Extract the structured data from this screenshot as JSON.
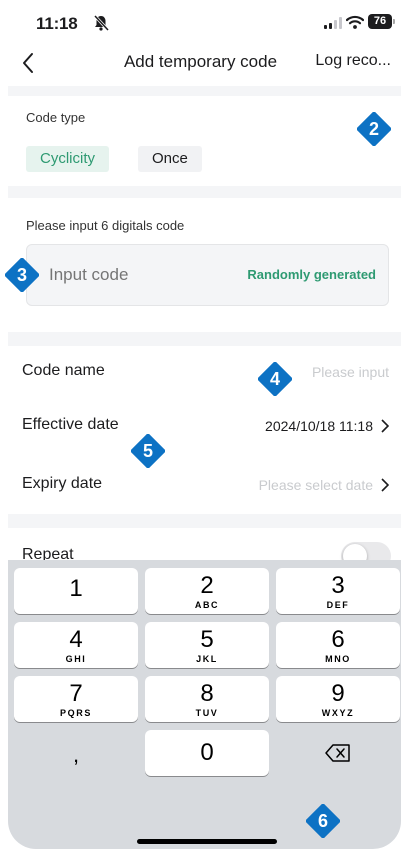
{
  "status_bar": {
    "time": "11:18",
    "battery": "76"
  },
  "nav": {
    "title": "Add temporary code",
    "right_label": "Log reco..."
  },
  "code_type": {
    "label": "Code type",
    "options": [
      "Cyclicity",
      "Once"
    ],
    "selected": "Cyclicity"
  },
  "code_input": {
    "label": "Please input 6 digitals code",
    "placeholder": "Input code",
    "random_label": "Randomly generated"
  },
  "rows": {
    "code_name": {
      "label": "Code name",
      "placeholder": "Please input"
    },
    "effective_date": {
      "label": "Effective date",
      "value": "2024/10/18 11:18"
    },
    "expiry_date": {
      "label": "Expiry date",
      "placeholder": "Please select date"
    },
    "repeat": {
      "label": "Repeat",
      "enabled": false
    }
  },
  "badges": [
    "2",
    "3",
    "4",
    "5",
    "6"
  ],
  "keyboard": {
    "keys": [
      {
        "digit": "1",
        "letters": ""
      },
      {
        "digit": "2",
        "letters": "ABC"
      },
      {
        "digit": "3",
        "letters": "DEF"
      },
      {
        "digit": "4",
        "letters": "GHI"
      },
      {
        "digit": "5",
        "letters": "JKL"
      },
      {
        "digit": "6",
        "letters": "MNO"
      },
      {
        "digit": "7",
        "letters": "PQRS"
      },
      {
        "digit": "8",
        "letters": "TUV"
      },
      {
        "digit": "9",
        "letters": "WXYZ"
      },
      {
        "digit": "0",
        "letters": ""
      }
    ],
    "comma": ",",
    "delete_icon": "delete-backspace-icon"
  },
  "colors": {
    "accent": "#2e9a72",
    "badge": "#0d72c4",
    "placeholder": "#c9cbce",
    "divider": "#f4f5f7",
    "keyboard_bg": "#d7dade"
  }
}
